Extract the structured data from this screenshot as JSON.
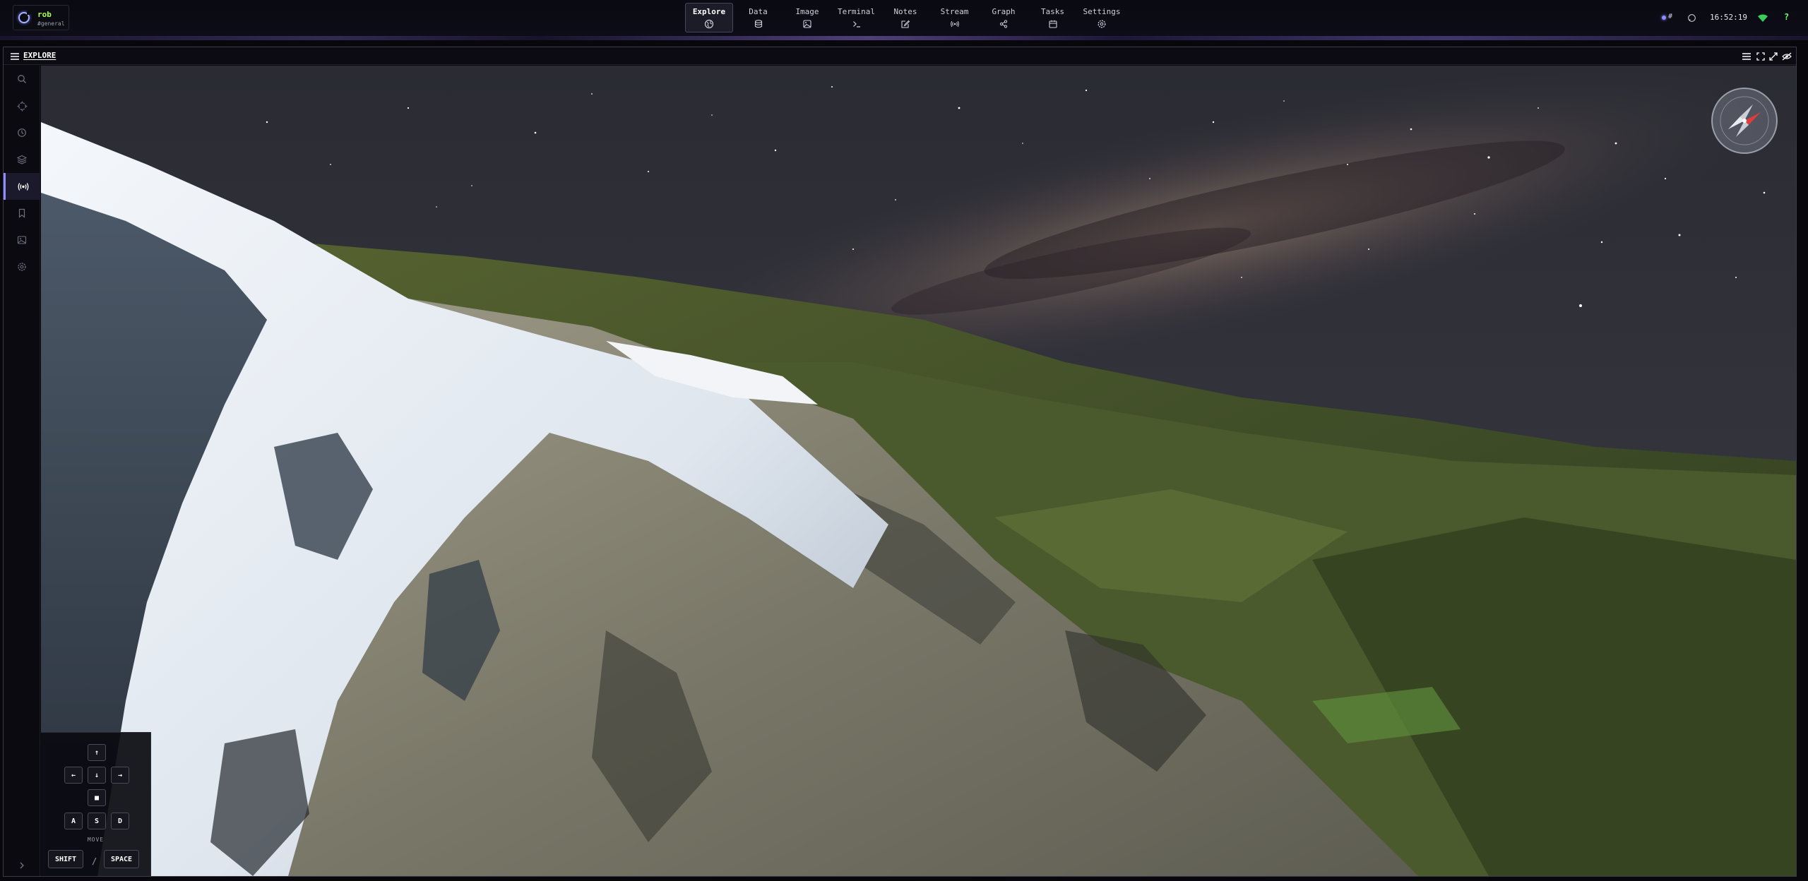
{
  "user": {
    "name": "rob",
    "channel": "#general"
  },
  "nav": {
    "tabs": [
      {
        "label": "Explore",
        "icon": "globe-icon",
        "active": true
      },
      {
        "label": "Data",
        "icon": "database-icon",
        "active": false
      },
      {
        "label": "Image",
        "icon": "image-icon",
        "active": false
      },
      {
        "label": "Terminal",
        "icon": "terminal-icon",
        "active": false
      },
      {
        "label": "Notes",
        "icon": "edit-icon",
        "active": false
      },
      {
        "label": "Stream",
        "icon": "broadcast-icon",
        "active": false
      },
      {
        "label": "Graph",
        "icon": "share-icon",
        "active": false
      },
      {
        "label": "Tasks",
        "icon": "calendar-icon",
        "active": false
      },
      {
        "label": "Settings",
        "icon": "gear-icon",
        "active": false
      }
    ]
  },
  "status": {
    "indicator": "#",
    "time": "16:52:19"
  },
  "panel": {
    "title": "EXPLORE"
  },
  "sidebar": {
    "items": [
      {
        "icon": "search-icon",
        "active": false
      },
      {
        "icon": "crosshair-icon",
        "active": false
      },
      {
        "icon": "history-icon",
        "active": false
      },
      {
        "icon": "layers-icon",
        "active": false
      },
      {
        "icon": "broadcast-icon",
        "active": true
      },
      {
        "icon": "bookmark-icon",
        "active": false
      },
      {
        "icon": "image-icon",
        "active": false
      },
      {
        "icon": "gear-icon",
        "active": false
      }
    ]
  },
  "controls": {
    "up": "↑",
    "left": "←",
    "down": "↓",
    "right": "→",
    "stop": "■",
    "key_a": "A",
    "key_s": "S",
    "key_d": "D",
    "move_label": "MOVE",
    "shift": "SHIFT",
    "separator": "/",
    "space": "SPACE"
  },
  "colors": {
    "accent": "#8f8cff",
    "user_name": "#a6ff4d",
    "wifi": "#34d058",
    "help": "#6dff6d"
  }
}
